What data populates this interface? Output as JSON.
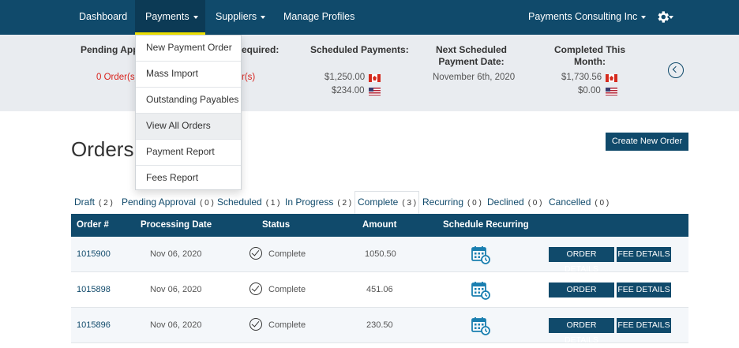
{
  "nav": {
    "dashboard": "Dashboard",
    "payments": "Payments",
    "suppliers": "Suppliers",
    "manage_profiles": "Manage Profiles",
    "company": "Payments Consulting Inc",
    "settings_icon": "gear-icon"
  },
  "summary": {
    "pending_title": "Pending Appro",
    "pending_value": "0 Order(s)",
    "required_title": "equired:",
    "required_value": "r(s)",
    "scheduled_title": "Scheduled Payments:",
    "scheduled_cad": "$1,250.00",
    "scheduled_usd": "$234.00",
    "next_title_1": "Next Scheduled",
    "next_title_2": "Payment Date:",
    "next_value": "November 6th, 2020",
    "completed_title_1": "Completed This",
    "completed_title_2": "Month:",
    "completed_cad": "$1,730.56",
    "completed_usd": "$0.00"
  },
  "dropdown": [
    "New Payment Order",
    "Mass Import",
    "Outstanding Payables",
    "View All Orders",
    "Payment Report",
    "Fees Report"
  ],
  "page": {
    "title": "Orders",
    "create_button": "Create New Order"
  },
  "tabs": [
    {
      "label": "Draft",
      "count": "( 2 )"
    },
    {
      "label": "Pending Approval",
      "count": "( 0 )"
    },
    {
      "label": "Scheduled",
      "count": "( 1 )"
    },
    {
      "label": "In Progress",
      "count": "( 2 )"
    },
    {
      "label": "Complete",
      "count": "( 3 )"
    },
    {
      "label": "Recurring",
      "count": "( 0 )"
    },
    {
      "label": "Declined",
      "count": "( 0 )"
    },
    {
      "label": "Cancelled",
      "count": "( 0 )"
    }
  ],
  "table": {
    "headers": [
      "Order #",
      "Processing Date",
      "Status",
      "Amount",
      "Schedule Recurring"
    ],
    "rows": [
      {
        "order": "1015900",
        "date": "Nov 06, 2020",
        "status": "Complete",
        "amount": "1050.50"
      },
      {
        "order": "1015898",
        "date": "Nov 06, 2020",
        "status": "Complete",
        "amount": "451.06"
      },
      {
        "order": "1015896",
        "date": "Nov 06, 2020",
        "status": "Complete",
        "amount": "230.50"
      }
    ],
    "order_details": "ORDER DETAILS",
    "fee_details": "FEE DETAILS"
  },
  "colors": {
    "brand": "#104a6b",
    "accent": "#f0e300",
    "danger": "#d9231d"
  }
}
